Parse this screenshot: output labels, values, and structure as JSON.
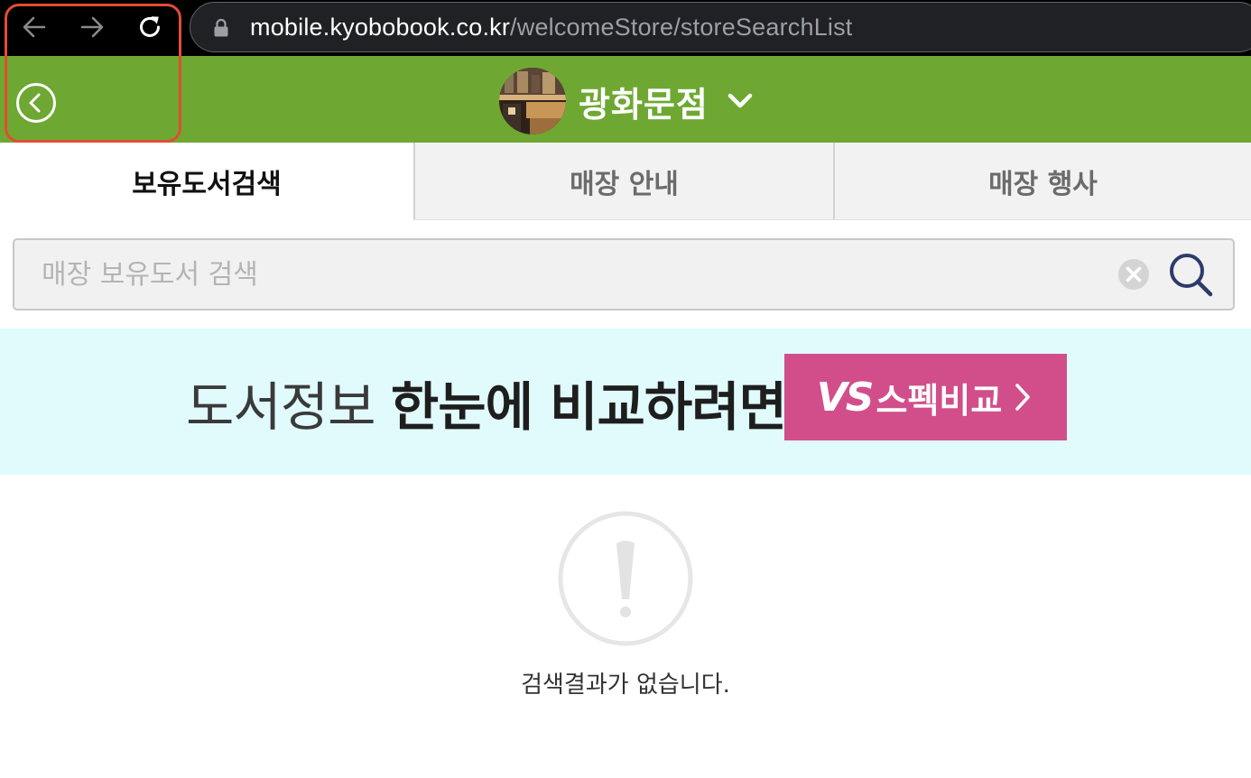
{
  "browser": {
    "url_host": "mobile.kyobobook.co.kr",
    "url_path": "/welcomeStore/storeSearchList"
  },
  "header": {
    "store_name": "광화문점"
  },
  "tabs": [
    {
      "label": "보유도서검색",
      "active": true
    },
    {
      "label": "매장 안내",
      "active": false
    },
    {
      "label": "매장 행사",
      "active": false
    }
  ],
  "search": {
    "placeholder": "매장 보유도서 검색",
    "value": ""
  },
  "banner": {
    "text_light": "도서정보 ",
    "text_bold": "한눈에 비교하려면",
    "button_logo": "VS",
    "button_label": "스펙비교"
  },
  "empty_state": {
    "message": "검색결과가 없습니다."
  },
  "colors": {
    "header_green": "#6ea832",
    "banner_bg": "#e1fbfd",
    "vs_button": "#d24e8a",
    "highlight": "#e24d32"
  }
}
